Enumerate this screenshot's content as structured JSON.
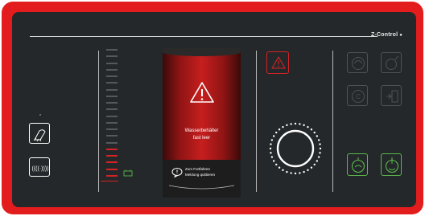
{
  "brand": {
    "name": "Z-Control",
    "mark": "●"
  },
  "display": {
    "message_line1": "Wasserbehälter",
    "message_line2": "fast leer",
    "ack_line1": "Zum Fortfahren",
    "ack_line2": "Meldung quittieren"
  },
  "left_controls": {
    "lamp_button": {
      "icon": "light-beam-icon"
    },
    "vibration_button": {
      "icon": "vibration-icon"
    }
  },
  "level_meter": {
    "total_segments": 20,
    "active_red_segments": 5,
    "battery_icon": "battery-icon"
  },
  "alert": {
    "icon": "warning-triangle-icon"
  },
  "dial": {
    "icon": "rotary-knob-icon"
  },
  "right_controls": {
    "items": [
      {
        "icon": "pump-icon",
        "state": "inactive"
      },
      {
        "icon": "drop-target-icon",
        "state": "inactive"
      },
      {
        "icon": "c-dial-icon",
        "state": "inactive"
      },
      {
        "icon": "door-open-icon",
        "state": "inactive"
      },
      {
        "icon": "gauge-down-icon",
        "state": "active"
      },
      {
        "icon": "gauge-power-icon",
        "state": "active"
      }
    ]
  },
  "colors": {
    "frame": "#e31d1d",
    "panel": "#24282a",
    "active_green": "#59b84a",
    "alert_red": "#d42323"
  }
}
